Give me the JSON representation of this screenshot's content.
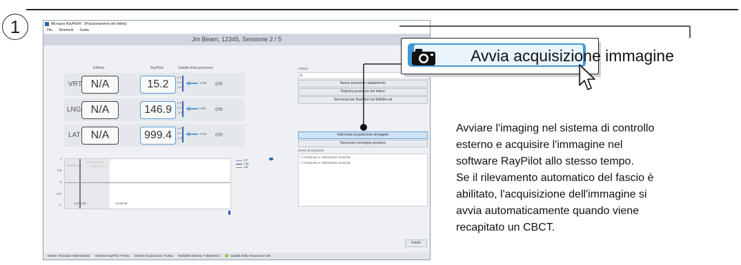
{
  "step_number": "1",
  "app": {
    "window_title": "Micropos RayPilot® - [Posizionamento del lettino]",
    "menu": [
      "File",
      "Strumenti",
      "Guida"
    ],
    "headline": "Jm Beam, 12345, Sessione 2 / 5",
    "columns": {
      "effective": "Effettivi",
      "raypilot": "RayPilot",
      "validity": "Validità della posizione"
    },
    "rows": [
      {
        "label": "VRT",
        "effective": "N/A",
        "raypilot": "15.2",
        "tol_hi": "0.5",
        "tol_mid": "0.0",
        "tol_lo": "-0.5",
        "delta": "-0.03",
        "unit": "cm"
      },
      {
        "label": "LNG",
        "effective": "N/A",
        "raypilot": "146.9",
        "tol_hi": "0.5",
        "tol_mid": "0.0",
        "tol_lo": "-0.5",
        "delta": "0.00",
        "unit": "cm"
      },
      {
        "label": "LAT",
        "effective": "N/A",
        "raypilot": "999.4",
        "tol_hi": "0.5",
        "tol_mid": "0.0",
        "tol_lo": "-0.5",
        "delta": "-0.04",
        "unit": "cm"
      }
    ],
    "graph": {
      "y_ticks": [
        "1",
        "0.5",
        "0",
        "-0.5",
        "-1"
      ],
      "x_ticks": [
        "14:54:30",
        "14:55:00"
      ],
      "ghost_labels": [
        "Posizione 1",
        "Posizione 2",
        "Vista ideale 1"
      ],
      "legend": [
        "Vrt",
        "Lng",
        "Lat"
      ]
    },
    "campo_label": "Campo",
    "campo_value": "f1",
    "campo_buttons": [
      "Nuovo posizione rapidamente",
      "Registra posizione del lettino",
      "Sincronizzare RayPilot con Effettivi ed"
    ],
    "stop_button": "Interrompi acquisizione immagine",
    "hide_button": "Nascondi cronologia posizioni",
    "events_label": "Eventi di posizione",
    "events": [
      "Posizione 1: 04/01/2022 14:54:05",
      "Posizione 2: 04/01/2022 14:54:25"
    ],
    "finish_button": "Finish",
    "status": [
      "Utente: Micropos Administrator",
      "Sistema RayPilot: Pronto",
      "Motore di posizione: Avviato",
      "Modalità sistema: Trattamento",
      "Qualità della misurazione OK"
    ],
    "colors": {
      "accent": "#3f9ad4",
      "value_border": "#5b9bd5",
      "bar": "#2a64b4",
      "ok": "#8cc63f"
    }
  },
  "callout": {
    "label": "Avvia acquisizione immagine",
    "icon": "camera-icon"
  },
  "description": [
    "Avviare l'imaging nel sistema di controllo",
    "esterno e acquisire l'immagine nel",
    "software RayPilot allo stesso tempo.",
    "Se il rilevamento automatico del fascio è",
    "abilitato, l'acquisizione dell'immagine si",
    "avvia automaticamente quando viene",
    "recapitato un CBCT."
  ]
}
